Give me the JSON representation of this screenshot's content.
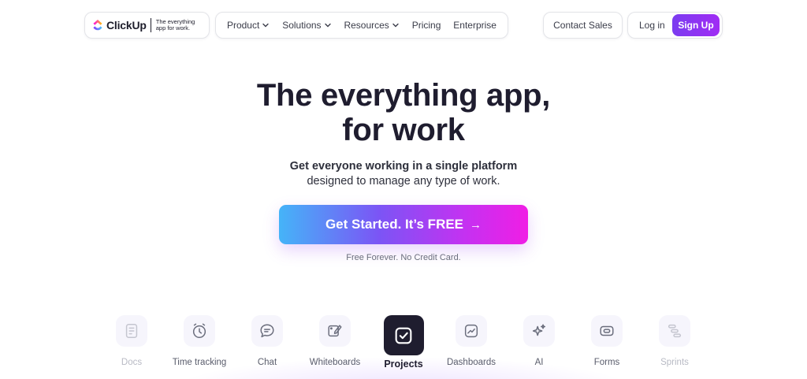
{
  "brand": {
    "name": "ClickUp",
    "tagline": "The everything app for work."
  },
  "nav": {
    "items": [
      {
        "label": "Product",
        "has_dropdown": true
      },
      {
        "label": "Solutions",
        "has_dropdown": true
      },
      {
        "label": "Resources",
        "has_dropdown": true
      },
      {
        "label": "Pricing",
        "has_dropdown": false
      },
      {
        "label": "Enterprise",
        "has_dropdown": false
      }
    ],
    "contact_sales": "Contact Sales",
    "login": "Log in",
    "signup": "Sign Up"
  },
  "hero": {
    "title_line1": "The everything app,",
    "title_line2": "for work",
    "subtitle_line1": "Get everyone working in a single platform",
    "subtitle_line2": "designed to manage any type of work.",
    "cta_label": "Get Started. It’s FREE",
    "cta_arrow": "→",
    "cta_note": "Free Forever. No Credit Card."
  },
  "features": [
    {
      "label": "Docs",
      "icon": "doc-icon",
      "state": "faded"
    },
    {
      "label": "Time tracking",
      "icon": "clock-icon",
      "state": "normal"
    },
    {
      "label": "Chat",
      "icon": "chat-icon",
      "state": "normal"
    },
    {
      "label": "Whiteboards",
      "icon": "whiteboard-icon",
      "state": "normal"
    },
    {
      "label": "Projects",
      "icon": "checkbox-icon",
      "state": "active"
    },
    {
      "label": "Dashboards",
      "icon": "chart-icon",
      "state": "normal"
    },
    {
      "label": "AI",
      "icon": "sparkle-icon",
      "state": "normal"
    },
    {
      "label": "Forms",
      "icon": "form-icon",
      "state": "normal"
    },
    {
      "label": "Sprints",
      "icon": "sprints-icon",
      "state": "faded"
    }
  ],
  "colors": {
    "brand_purple": "#7b3cf0",
    "dark": "#1f1d2f",
    "cta_gradient_start": "#45b4f8",
    "cta_gradient_end": "#f01ee5"
  }
}
